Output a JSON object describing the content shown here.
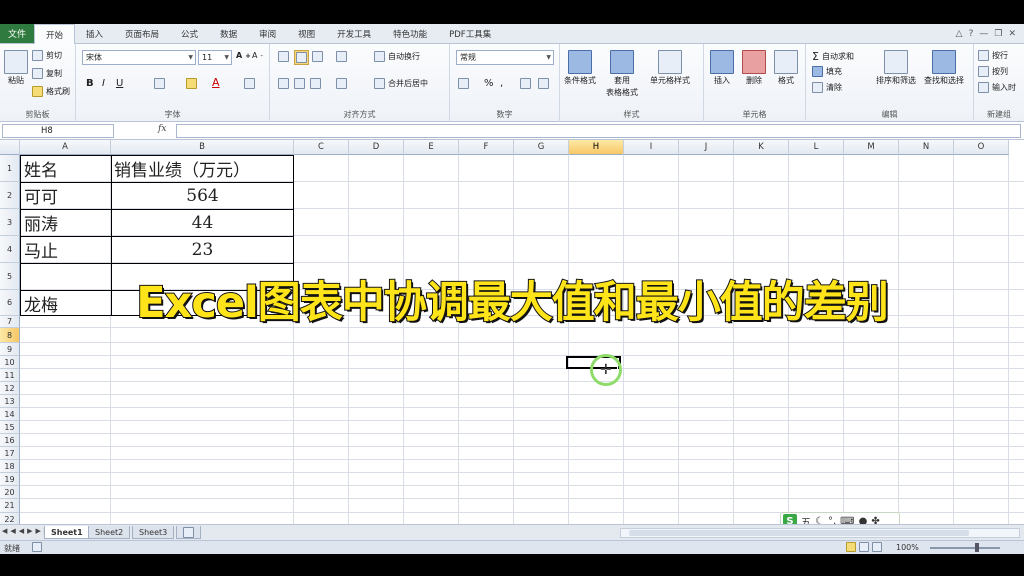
{
  "ribbon_tabs": [
    "文件",
    "开始",
    "插入",
    "页面布局",
    "公式",
    "数据",
    "审阅",
    "视图",
    "开发工具",
    "特色功能",
    "PDF工具集"
  ],
  "clipboard": {
    "paste": "粘贴",
    "cut": "剪切",
    "copy": "复制",
    "format_painter": "格式刷",
    "label": "剪贴板"
  },
  "font": {
    "name": "宋体",
    "size": "11",
    "label": "字体"
  },
  "alignment": {
    "wrap": "自动换行",
    "merge": "合并后居中",
    "label": "对齐方式"
  },
  "number": {
    "format": "常规",
    "label": "数字"
  },
  "styles": {
    "conditional": "条件格式",
    "table_line1": "套用",
    "table_line2": "表格格式",
    "cell_styles": "单元格样式",
    "label": "样式"
  },
  "cells": {
    "insert": "插入",
    "delete": "删除",
    "format": "格式",
    "label": "单元格"
  },
  "editing": {
    "autosum": "自动求和",
    "fill": "填充",
    "clear": "清除",
    "sort": "排序和筛选",
    "find": "查找和选择",
    "label": "编辑"
  },
  "new_group": {
    "line1": "按行",
    "line2": "按列",
    "line3": "输入时",
    "label": "新建组"
  },
  "formula_bar": {
    "name_box": "H8",
    "fx": "fx",
    "value": ""
  },
  "columns": [
    "A",
    "B",
    "C",
    "D",
    "E",
    "F",
    "G",
    "H",
    "I",
    "J",
    "K",
    "L",
    "M",
    "N",
    "O"
  ],
  "rows": [
    "1",
    "2",
    "3",
    "4",
    "5",
    "6",
    "7",
    "8",
    "9",
    "10",
    "11",
    "12",
    "13",
    "14",
    "15",
    "16",
    "17",
    "18",
    "19",
    "20",
    "21",
    "22"
  ],
  "table": {
    "header": {
      "name": "姓名",
      "sales": "销售业绩（万元）"
    },
    "rows": [
      {
        "name": "可可",
        "sales": "564"
      },
      {
        "name": "丽涛",
        "sales": "44"
      },
      {
        "name": "马止",
        "sales": "23"
      },
      {
        "name": "",
        "sales": ""
      },
      {
        "name": "龙梅",
        "sales": ""
      }
    ]
  },
  "overlay_title": "Excel图表中协调最大值和最小值的差别",
  "sheets": [
    "Sheet1",
    "Sheet2",
    "Sheet3"
  ],
  "ime": {
    "logo": "S",
    "mode": "五"
  },
  "status": {
    "ready": "就绪",
    "zoom": "100%"
  }
}
